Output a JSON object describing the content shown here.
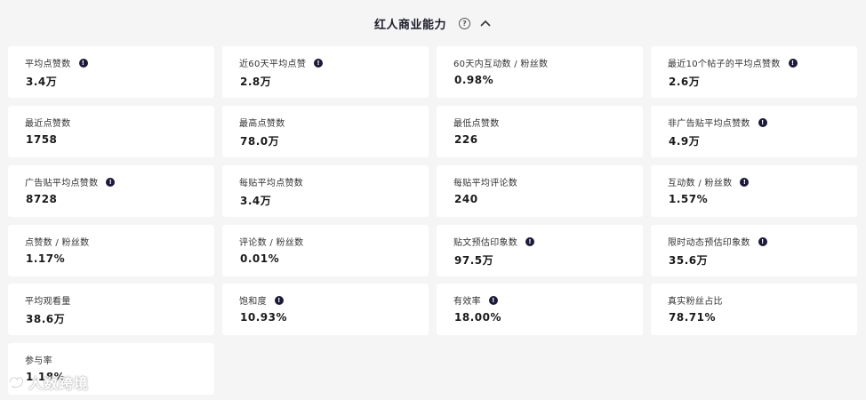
{
  "header": {
    "title": "红人商业能力",
    "help_icon": "?",
    "collapse_icon": "chevron-up-icon"
  },
  "metrics": [
    {
      "label": "平均点赞数",
      "value": "3.4万",
      "info": true
    },
    {
      "label": "近60天平均点赞",
      "value": "2.8万",
      "info": true
    },
    {
      "label": "60天内互动数 / 粉丝数",
      "value": "0.98%",
      "info": false
    },
    {
      "label": "最近10个帖子的平均点赞数",
      "value": "2.6万",
      "info": true
    },
    {
      "label": "最近点赞数",
      "value": "1758",
      "info": false
    },
    {
      "label": "最高点赞数",
      "value": "78.0万",
      "info": false
    },
    {
      "label": "最低点赞数",
      "value": "226",
      "info": false
    },
    {
      "label": "非广告贴平均点赞数",
      "value": "4.9万",
      "info": true
    },
    {
      "label": "广告贴平均点赞数",
      "value": "8728",
      "info": true
    },
    {
      "label": "每贴平均点赞数",
      "value": "3.4万",
      "info": false
    },
    {
      "label": "每贴平均评论数",
      "value": "240",
      "info": false
    },
    {
      "label": "互动数 / 粉丝数",
      "value": "1.57%",
      "info": true
    },
    {
      "label": "点赞数 / 粉丝数",
      "value": "1.17%",
      "info": false
    },
    {
      "label": "评论数 / 粉丝数",
      "value": "0.01%",
      "info": false
    },
    {
      "label": "贴文预估印象数",
      "value": "97.5万",
      "info": true
    },
    {
      "label": "限时动态预估印象数",
      "value": "35.6万",
      "info": true
    },
    {
      "label": "平均观看量",
      "value": "38.6万",
      "info": false
    },
    {
      "label": "饱和度",
      "value": "10.93%",
      "info": true
    },
    {
      "label": "有效率",
      "value": "18.00%",
      "info": true
    },
    {
      "label": "真实粉丝占比",
      "value": "78.71%",
      "info": false
    },
    {
      "label": "参与率",
      "value": "1.18%",
      "info": false
    }
  ],
  "info_glyph": "!",
  "watermark": {
    "text": "人数跨境"
  }
}
